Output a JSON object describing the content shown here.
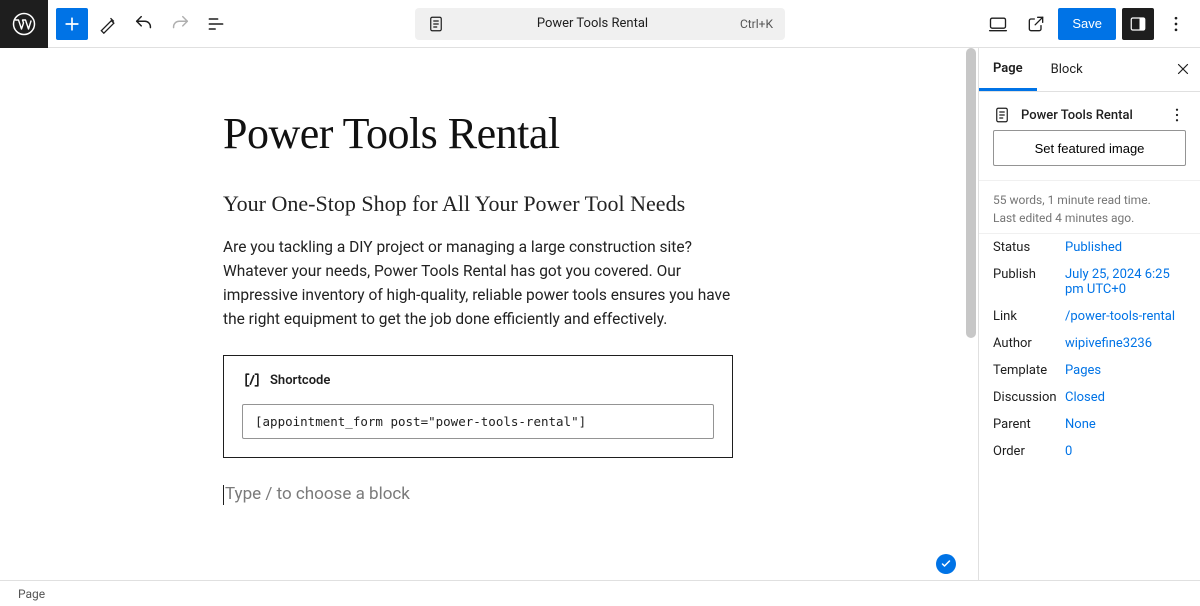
{
  "topbar": {
    "doc_title": "Power Tools Rental",
    "shortcut": "Ctrl+K",
    "save_label": "Save"
  },
  "editor": {
    "title": "Power Tools Rental",
    "subheading": "Your One-Stop Shop for All Your Power Tool Needs",
    "paragraph": "Are you tackling a DIY project or managing a large construction site? Whatever your needs, Power Tools Rental has got you covered. Our impressive inventory of high-quality, reliable power tools ensures you have the right equipment to get the job done efficiently and effectively.",
    "shortcode_block": {
      "label": "Shortcode",
      "value": "[appointment_form post=\"power-tools-rental\"]"
    },
    "new_block_placeholder": "Type / to choose a block"
  },
  "sidebar": {
    "tabs": {
      "page": "Page",
      "block": "Block"
    },
    "doc_title": "Power Tools Rental",
    "featured_image_label": "Set featured image",
    "meta": {
      "word_count": "55 words, 1 minute read time.",
      "last_edited": "Last edited 4 minutes ago."
    },
    "fields": {
      "status": {
        "label": "Status",
        "value": "Published"
      },
      "publish": {
        "label": "Publish",
        "value": "July 25, 2024 6:25 pm UTC+0"
      },
      "link": {
        "label": "Link",
        "value": "/power-tools-rental"
      },
      "author": {
        "label": "Author",
        "value": "wipivefine3236"
      },
      "template": {
        "label": "Template",
        "value": "Pages"
      },
      "discussion": {
        "label": "Discussion",
        "value": "Closed"
      },
      "parent": {
        "label": "Parent",
        "value": "None"
      },
      "order": {
        "label": "Order",
        "value": "0"
      }
    }
  },
  "footer": {
    "breadcrumb": "Page"
  }
}
